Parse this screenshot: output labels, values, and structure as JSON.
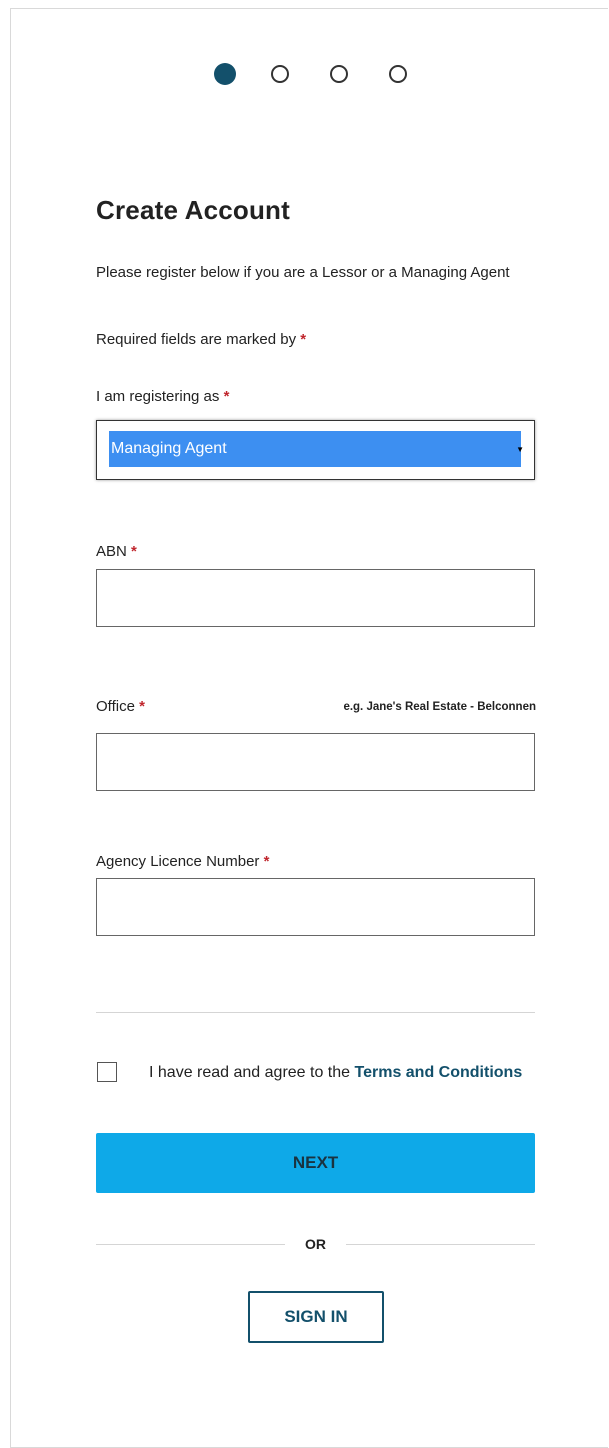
{
  "steps": {
    "total": 4,
    "active": 1
  },
  "title": "Create Account",
  "intro": "Please register below if you are a Lessor or a Managing Agent",
  "required_note": "Required fields are marked by",
  "required_marker": "*",
  "fields": {
    "role": {
      "label": "I am registering as",
      "value": "Managing Agent"
    },
    "abn": {
      "label": "ABN",
      "value": ""
    },
    "office": {
      "label": "Office",
      "hint": "e.g. Jane's Real Estate - Belconnen",
      "value": ""
    },
    "licence": {
      "label": "Agency Licence Number",
      "value": ""
    }
  },
  "terms": {
    "prefix": "I have read and agree to the",
    "link": "Terms and Conditions",
    "checked": false
  },
  "buttons": {
    "next": "NEXT",
    "or": "OR",
    "sign_in": "SIGN IN"
  },
  "colors": {
    "brand_dark": "#13506b",
    "primary_button": "#0ea9e8",
    "required": "#c0262d",
    "select_highlight": "#3d8ff1"
  },
  "icons": {
    "dropdown": "caret-down-icon",
    "step_active": "filled-circle",
    "step_inactive": "hollow-circle"
  }
}
